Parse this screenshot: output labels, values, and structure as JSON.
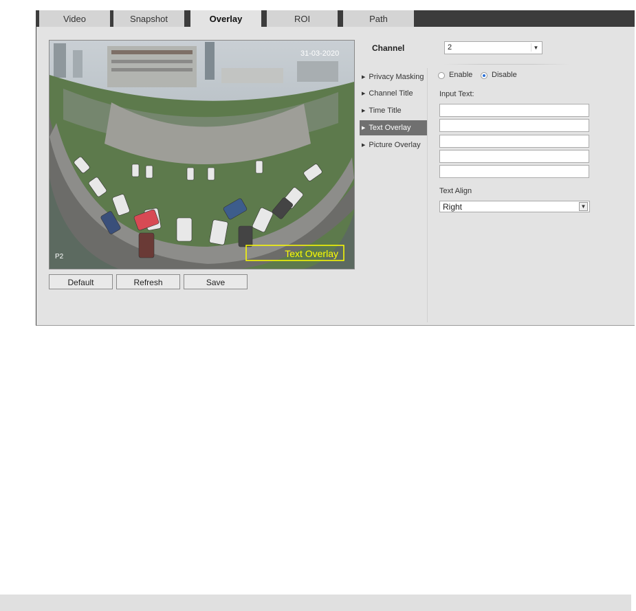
{
  "tabs": [
    "Video",
    "Snapshot",
    "Overlay",
    "ROI",
    "Path"
  ],
  "active_tab": "Overlay",
  "preview": {
    "timestamp": "31-03-2020",
    "channel_label": "P2",
    "text_overlay": "Text Overlay"
  },
  "buttons": {
    "default": "Default",
    "refresh": "Refresh",
    "save": "Save"
  },
  "channel": {
    "label": "Channel",
    "value": "2"
  },
  "menu": [
    "Privacy Masking",
    "Channel Title",
    "Time Title",
    "Text Overlay",
    "Picture Overlay"
  ],
  "active_menu": "Text Overlay",
  "enable": {
    "enable_label": "Enable",
    "disable_label": "Disable",
    "selected": "Disable"
  },
  "input_text": {
    "label": "Input Text:",
    "lines": [
      "",
      "",
      "",
      "",
      ""
    ]
  },
  "text_align": {
    "label": "Text Align",
    "value": "Right"
  },
  "colors": {
    "tab_bar": "#3c3c3c",
    "panel": "#e3e3e3",
    "active_menu": "#707070",
    "overlay_box": "#ffff00"
  }
}
